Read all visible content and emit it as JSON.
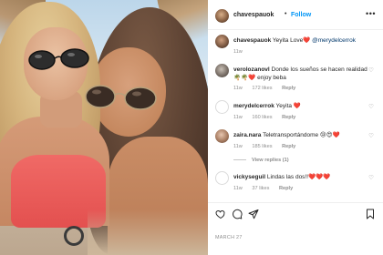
{
  "post": {
    "author": "chavespauok",
    "follow_label": "Follow",
    "header_dot": "•",
    "more_label": "•••",
    "date": "MARCH 27"
  },
  "caption": {
    "username": "chavespauok",
    "text": "Yeyita Love",
    "emoji": "❤️",
    "mention": "@merydelcerrok",
    "time": "11w"
  },
  "comments": [
    {
      "username": "verolozanovl",
      "text": "Donde los sueños se hacen realidad 🌴🌴❤️ enjoy beba",
      "time": "11w",
      "likes": "172 likes",
      "reply": "Reply"
    },
    {
      "username": "merydelcerrok",
      "text": "Yeyita ❤️",
      "time": "11w",
      "likes": "160 likes",
      "reply": "Reply"
    },
    {
      "username": "zaira.nara",
      "text": "Teletransportándome 😢😍❤️",
      "time": "11w",
      "likes": "185 likes",
      "reply": "Reply",
      "view_replies": "View replies (1)"
    },
    {
      "username": "vickyseguil",
      "text": "Lindas las dos!!❤️❤️❤️",
      "time": "11w",
      "likes": "37 likes",
      "reply": "Reply"
    }
  ],
  "icons": {
    "like": "heart-outline-icon",
    "comment": "comment-icon",
    "share": "share-icon",
    "save": "bookmark-icon"
  },
  "colors": {
    "link_blue": "#0095f6",
    "heart_red": "#ed4956",
    "muted_gray": "#8e8e8e"
  }
}
